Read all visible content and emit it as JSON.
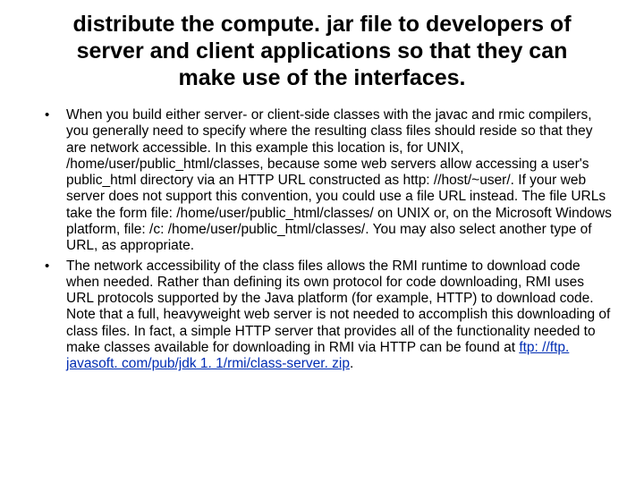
{
  "title": "distribute the compute. jar file to developers of server and client applications so that they can make use of the interfaces.",
  "bullets": [
    {
      "text": "When you build either server- or client-side classes with the javac and rmic compilers, you generally need to specify where the resulting class files should reside so that they are network accessible. In this example this location is, for UNIX, /home/user/public_html/classes, because some web servers allow accessing a user's public_html directory via an HTTP URL constructed as http: //host/~user/. If your web server does not support this convention, you could use a file URL instead. The file URLs take the form file: /home/user/public_html/classes/ on UNIX or, on the Microsoft Windows platform, file: /c: /home/user/public_html/classes/. You may also select another type of URL, as appropriate."
    },
    {
      "text": "The network accessibility of the class files allows the RMI runtime to download code when needed. Rather than defining its own protocol for code downloading, RMI uses URL protocols supported by the Java platform (for example, HTTP) to download code. Note that a full, heavyweight web server is not needed to accomplish this downloading of class files. In fact, a simple HTTP server that provides all of the functionality needed to make classes available for downloading in RMI via HTTP can be found at ",
      "link_text": "ftp: //ftp. javasoft. com/pub/jdk 1. 1/rmi/class-server. zip",
      "after_link": "."
    }
  ]
}
